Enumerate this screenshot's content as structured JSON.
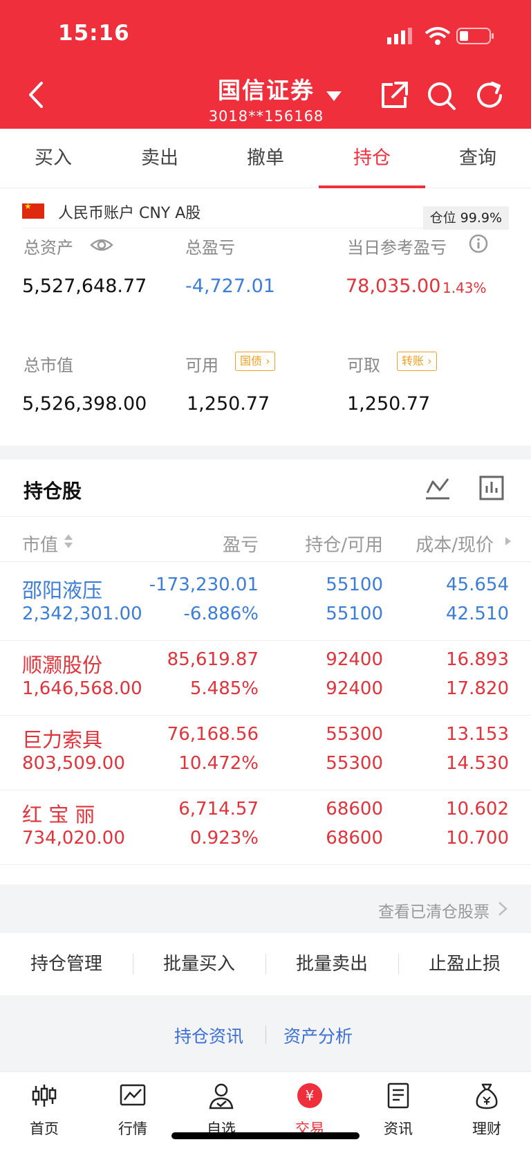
{
  "status": {
    "time": "15:16"
  },
  "header": {
    "broker": "国信证券",
    "account": "3018**156168"
  },
  "tabs": [
    "买入",
    "卖出",
    "撤单",
    "持仓",
    "查询"
  ],
  "summary": {
    "account_label": "人民币账户 CNY A股",
    "position_label": "仓位",
    "position_value": "99.9%",
    "total_assets_label": "总资产",
    "total_assets": "5,527,648.77",
    "total_pl_label": "总盈亏",
    "total_pl": "-4,727.01",
    "day_pl_label": "当日参考盈亏",
    "day_pl": "78,035.00",
    "day_pl_pct": "1.43%",
    "market_value_label": "总市值",
    "market_value": "5,526,398.00",
    "available_label": "可用",
    "available": "1,250.77",
    "available_tag": "国债",
    "withdrawable_label": "可取",
    "withdrawable": "1,250.77",
    "withdrawable_tag": "转账"
  },
  "holdings": {
    "title": "持仓股",
    "columns": [
      "市值",
      "盈亏",
      "持仓/可用",
      "成本/现价"
    ],
    "rows": [
      {
        "name": "邵阳液压",
        "mv": "2,342,301.00",
        "pl": "-173,230.01",
        "pl_pct": "-6.886%",
        "hold": "55100",
        "avail": "55100",
        "cost": "45.654",
        "price": "42.510",
        "color": "#3b7dd8"
      },
      {
        "name": "顺灏股份",
        "mv": "1,646,568.00",
        "pl": "85,619.87",
        "pl_pct": "5.485%",
        "hold": "92400",
        "avail": "92400",
        "cost": "16.893",
        "price": "17.820",
        "color": "#e2333b"
      },
      {
        "name": "巨力索具",
        "mv": "803,509.00",
        "pl": "76,168.56",
        "pl_pct": "10.472%",
        "hold": "55300",
        "avail": "55300",
        "cost": "13.153",
        "price": "14.530",
        "color": "#e2333b"
      },
      {
        "name": "红 宝 丽",
        "mv": "734,020.00",
        "pl": "6,714.57",
        "pl_pct": "0.923%",
        "hold": "68600",
        "avail": "68600",
        "cost": "10.602",
        "price": "10.700",
        "color": "#e2333b"
      }
    ],
    "cleared_link": "查看已清仓股票"
  },
  "actions": [
    "持仓管理",
    "批量买入",
    "批量卖出",
    "止盈止损"
  ],
  "links": {
    "news": "持仓资讯",
    "analysis": "资产分析"
  },
  "nav": [
    "首页",
    "行情",
    "自选",
    "交易",
    "资讯",
    "理财"
  ],
  "colors": {
    "brand": "#ef2f3c",
    "up": "#e2333b",
    "down": "#3b7dd8",
    "link": "#3b6fd6"
  }
}
